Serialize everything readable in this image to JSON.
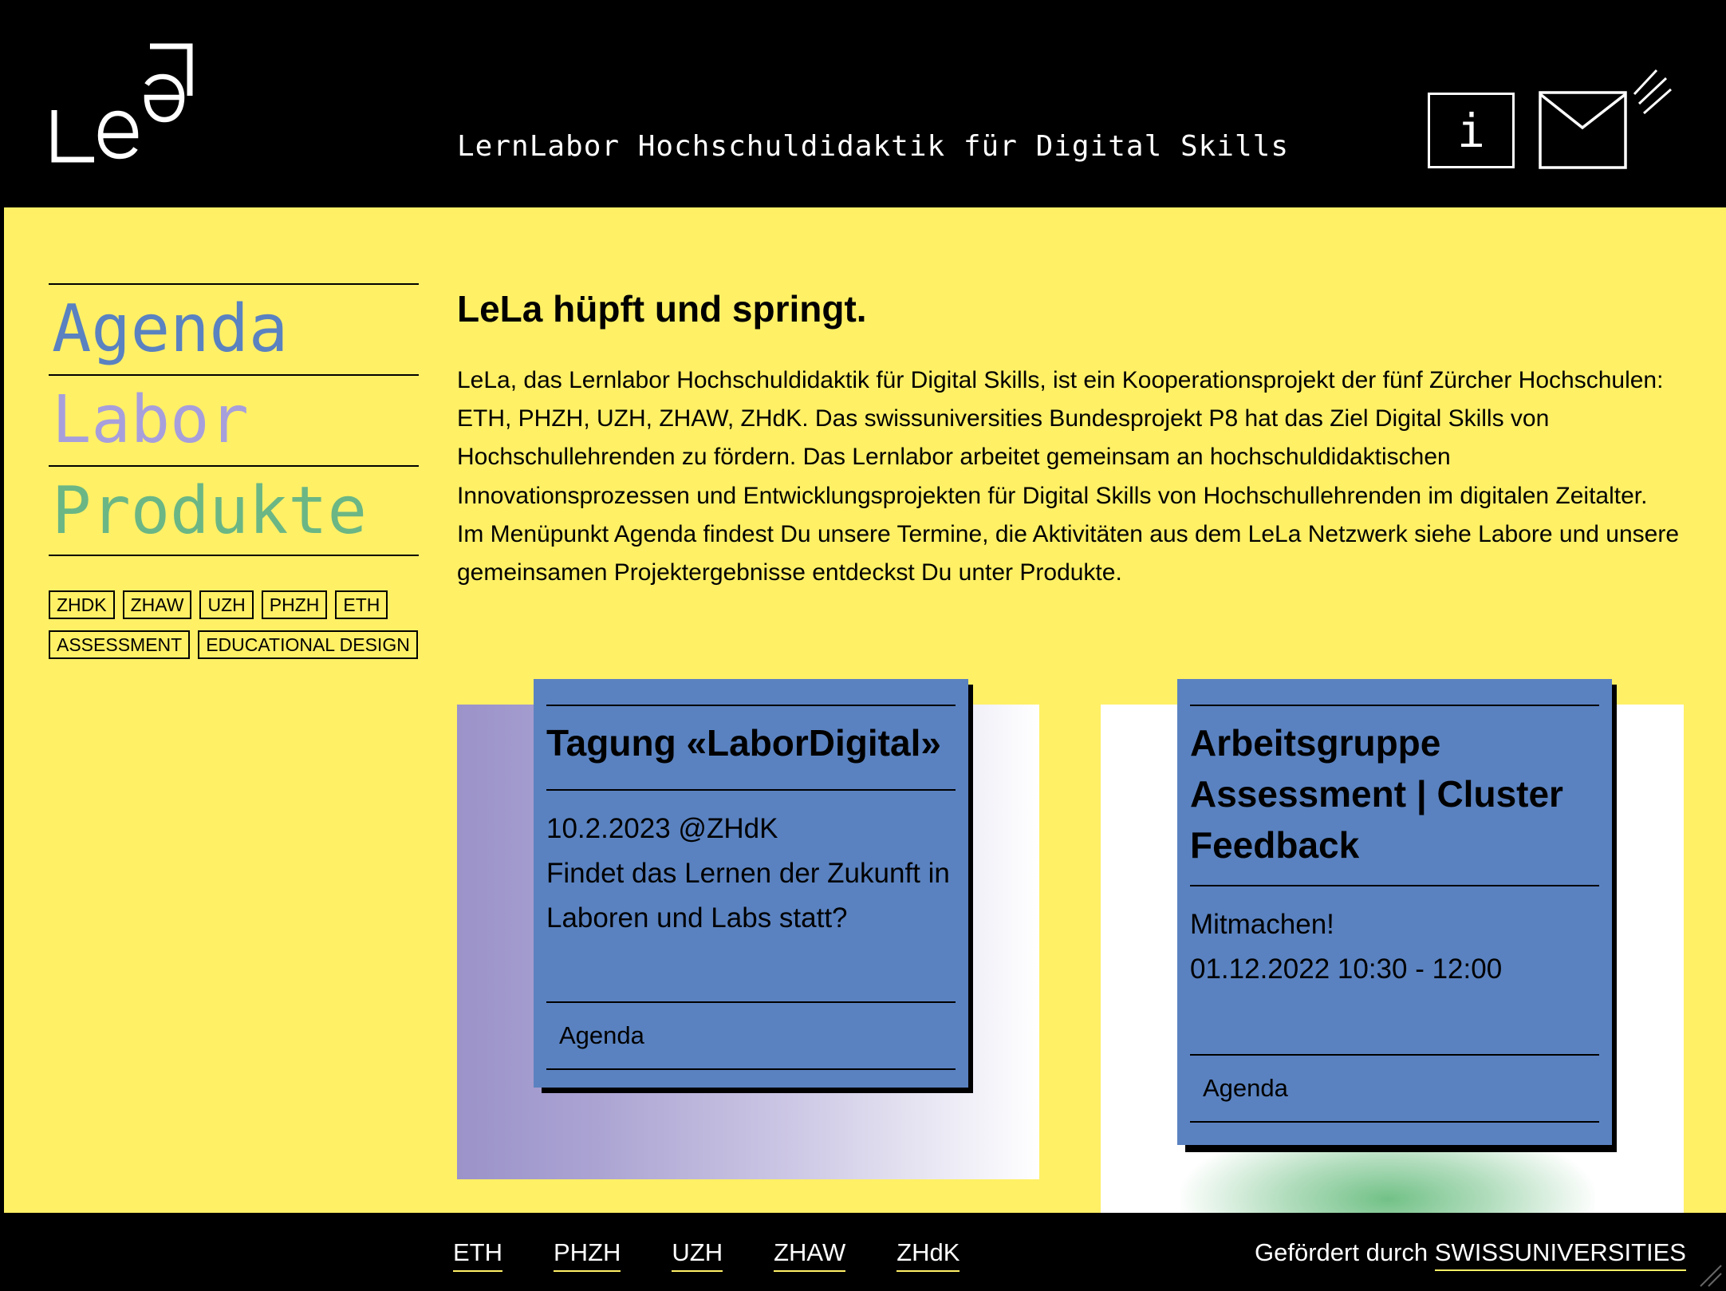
{
  "header": {
    "title": "LernLabor Hochschuldidaktik für Digital Skills",
    "info_label": "i",
    "icons": {
      "logo": "lela-logo",
      "info": "info-icon",
      "mail": "mail-icon"
    }
  },
  "nav": {
    "items": [
      {
        "label": "Agenda",
        "color": "#5a82c0"
      },
      {
        "label": "Labor",
        "color": "#a79fdc"
      },
      {
        "label": "Produkte",
        "color": "#6bb685"
      }
    ]
  },
  "tags": [
    "ZHDK",
    "ZHAW",
    "UZH",
    "PHZH",
    "ETH",
    "ASSESSMENT",
    "EDUCATIONAL DESIGN"
  ],
  "main": {
    "headline": "LeLa hüpft und springt.",
    "paragraphs": [
      "LeLa, das Lernlabor Hochschuldidaktik für Digital Skills, ist ein Kooperationsprojekt der fünf Zürcher Hochschulen: ETH, PHZH, UZH, ZHAW, ZHdK. Das swissuniversities Bundesprojekt P8 hat das Ziel Digital Skills von Hochschullehrenden zu fördern. Das Lernlabor arbeitet gemeinsam an hochschuldidaktischen Innovationsprozessen und Entwicklungsprojekten für Digital Skills von Hochschullehrenden im digitalen Zeitalter.",
      "Im Menüpunkt Agenda findest Du unsere Termine, die Aktivitäten aus dem LeLa Netzwerk siehe Labore und unsere gemeinsamen Projektergebnisse entdeckst Du unter Produkte."
    ]
  },
  "cards": [
    {
      "title": "Tagung «LaborDigital»",
      "line1": "10.2.2023 @ZHdK",
      "line2": "Findet das Lernen der Zukunft in Laboren und Labs statt?",
      "link": "Agenda"
    },
    {
      "title": "Arbeitsgruppe Assessment | Cluster Feedback",
      "line1": "Mitmachen!",
      "line2": "01.12.2022 10:30 - 12:00",
      "link": "Agenda"
    }
  ],
  "footer": {
    "links": [
      "ETH",
      "PHZH",
      "UZH",
      "ZHAW",
      "ZHdK"
    ],
    "funded_prefix": "Gefördert durch",
    "sponsor": "SWISSUNIVERSITIES"
  },
  "colors": {
    "background": "#fff066",
    "card": "#5a82c0",
    "bar": "#000000"
  }
}
